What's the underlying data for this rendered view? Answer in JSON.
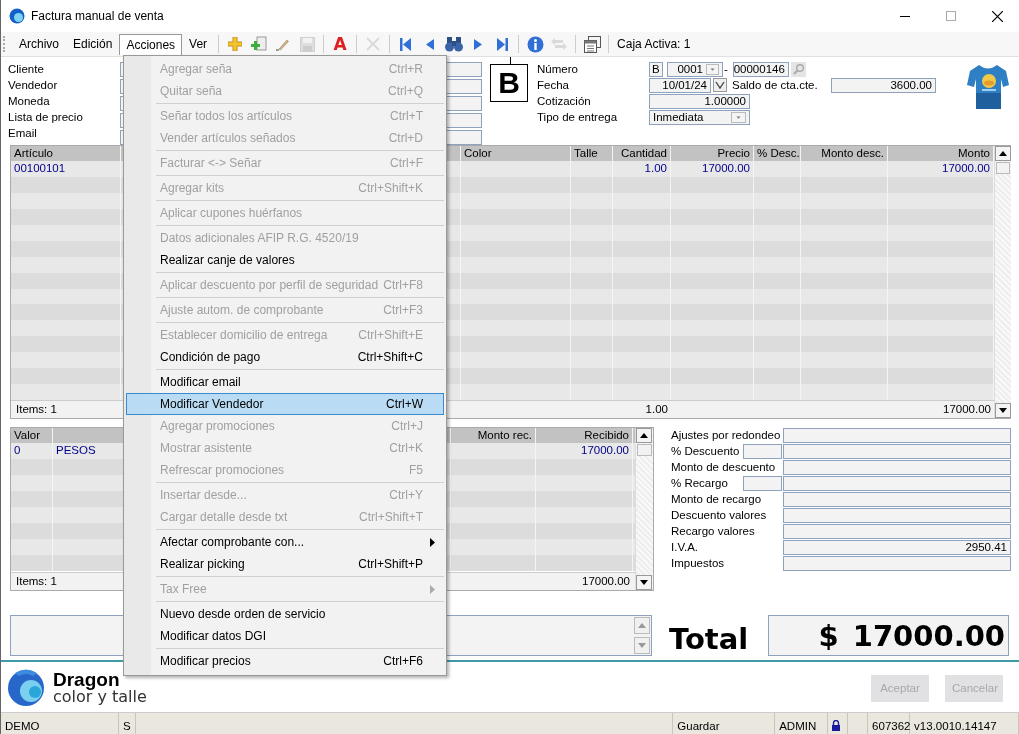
{
  "window": {
    "title": "Factura manual de venta"
  },
  "menubar": [
    {
      "label": "Archivo",
      "selected": false
    },
    {
      "label": "Edición",
      "selected": false
    },
    {
      "label": "Acciones",
      "selected": true
    },
    {
      "label": "Ver",
      "selected": false
    }
  ],
  "toolbar": {
    "groups": [
      [
        {
          "kind": "add",
          "disabled": false
        },
        {
          "kind": "add_item",
          "disabled": false
        },
        {
          "kind": "edit",
          "disabled": false
        },
        {
          "kind": "save",
          "disabled": true
        }
      ],
      [
        {
          "kind": "font",
          "glyph": "A",
          "disabled": false
        }
      ],
      [
        {
          "kind": "delete",
          "disabled": true
        }
      ],
      [
        {
          "kind": "first",
          "disabled": false
        },
        {
          "kind": "prev",
          "disabled": false
        },
        {
          "kind": "find",
          "disabled": false
        },
        {
          "kind": "next",
          "disabled": false
        },
        {
          "kind": "last",
          "disabled": false
        }
      ],
      [
        {
          "kind": "info",
          "disabled": false
        },
        {
          "kind": "swap",
          "disabled": true
        }
      ],
      [
        {
          "kind": "windows",
          "disabled": false
        }
      ]
    ],
    "caja": "Caja Activa: 1"
  },
  "customer_labels": [
    "Cliente",
    "Vendedor",
    "Moneda",
    "Lista de precio",
    "Email"
  ],
  "letter": "B",
  "document": {
    "numero": {
      "label": "Número",
      "letter": "B",
      "branch": "0001",
      "separator": "-",
      "number": "00000146"
    },
    "fecha": {
      "label": "Fecha",
      "value": "10/01/24"
    },
    "saldo": {
      "label": "Saldo de cta.cte.",
      "value": "3600.00"
    },
    "cotizacion": {
      "label": "Cotización",
      "value": "1.00000"
    },
    "tipo_entrega": {
      "label": "Tipo de entrega",
      "value": "Inmediata"
    }
  },
  "product_image": {
    "kind": "picture"
  },
  "items_grid": {
    "columns": [
      {
        "label": "Artículo",
        "kind": "text"
      },
      {
        "label": "Color",
        "kind": "text"
      },
      {
        "label": "Talle",
        "kind": "text"
      },
      {
        "label": "Cantidad",
        "kind": "number",
        "total": "1.00"
      },
      {
        "label": "Precio",
        "kind": "number"
      },
      {
        "label": "% Desc.",
        "kind": "number"
      },
      {
        "label": "Monto desc.",
        "kind": "number"
      },
      {
        "label": "Monto",
        "kind": "number",
        "total": "17000.00"
      }
    ],
    "rows": [
      {
        "cells": [
          "00100101",
          null,
          null,
          "1.00",
          "17000.00",
          null,
          null,
          "17000.00"
        ]
      }
    ],
    "items_count": "Items: 1"
  },
  "values_grid": {
    "columns": [
      {
        "label": "Valor",
        "kind": "text"
      },
      {
        "kind": "text"
      },
      {
        "label": "Monto rec.",
        "kind": "number"
      },
      {
        "label": "Recibido",
        "kind": "number",
        "total": "17000.00"
      }
    ],
    "rows": [
      {
        "cells": [
          "0",
          "PESOS",
          null,
          "17000.00"
        ]
      }
    ],
    "items_count": "Items: 1"
  },
  "adjustments": [
    {
      "label": "Ajustes por redondeo",
      "kind": "single"
    },
    {
      "label": "% Descuento",
      "kind": "percent"
    },
    {
      "label": "Monto de descuento",
      "kind": "single"
    },
    {
      "label": "% Recargo",
      "kind": "percent"
    },
    {
      "label": "Monto de recargo",
      "kind": "single"
    },
    {
      "label": "Descuento valores",
      "kind": "single"
    },
    {
      "label": "Recargo valores",
      "kind": "single"
    },
    {
      "label": "I.V.A.",
      "kind": "single",
      "value": "2950.41"
    },
    {
      "label": "Impuestos",
      "kind": "single"
    }
  ],
  "total": {
    "label": "Total",
    "currency": "$",
    "amount": "17000.00"
  },
  "logo": {
    "name": "Dragon",
    "tagline": "color y talle"
  },
  "buttons": [
    {
      "label": "Aceptar",
      "disabled": true
    },
    {
      "label": "Cancelar",
      "disabled": true
    }
  ],
  "status_bar": [
    {
      "kind": "text",
      "text": "DEMO"
    },
    {
      "kind": "text",
      "text": "S"
    },
    {
      "kind": "blank"
    },
    {
      "kind": "text",
      "text": "Guardar"
    },
    {
      "kind": "text",
      "text": "ADMIN"
    },
    {
      "kind": "lock"
    },
    {
      "kind": "blank"
    },
    {
      "kind": "text",
      "text": "607362"
    },
    {
      "kind": "text",
      "text": "v13.0010.14147"
    }
  ],
  "menu": {
    "groups": [
      [
        {
          "label": "Agregar seña",
          "shortcut": "Ctrl+R",
          "disabled": true,
          "selected": false,
          "submenu": false
        },
        {
          "label": "Quitar seña",
          "shortcut": "Ctrl+Q",
          "disabled": true,
          "selected": false,
          "submenu": false
        }
      ],
      [
        {
          "label": "Señar todos los artículos",
          "shortcut": "Ctrl+T",
          "disabled": true,
          "selected": false,
          "submenu": false
        },
        {
          "label": "Vender artículos señados",
          "shortcut": "Ctrl+D",
          "disabled": true,
          "selected": false,
          "submenu": false
        }
      ],
      [
        {
          "label": "Facturar <-> Señar",
          "shortcut": "Ctrl+F",
          "disabled": true,
          "selected": false,
          "submenu": false
        }
      ],
      [
        {
          "label": "Agregar kits",
          "shortcut": "Ctrl+Shift+K",
          "disabled": true,
          "selected": false,
          "submenu": false
        }
      ],
      [
        {
          "label": "Aplicar cupones huérfanos",
          "disabled": true,
          "selected": false,
          "submenu": false
        }
      ],
      [
        {
          "label": "Datos adicionales AFIP R.G. 4520/19",
          "disabled": true,
          "selected": false,
          "submenu": false
        },
        {
          "label": "Realizar canje de valores",
          "disabled": false,
          "selected": false,
          "submenu": false
        }
      ],
      [
        {
          "label": "Aplicar descuento por perfil de seguridad",
          "shortcut": "Ctrl+F8",
          "disabled": true,
          "selected": false,
          "submenu": false
        }
      ],
      [
        {
          "label": "Ajuste autom. de comprobante",
          "shortcut": "Ctrl+F3",
          "disabled": true,
          "selected": false,
          "submenu": false
        }
      ],
      [
        {
          "label": "Establecer domicilio de entrega",
          "shortcut": "Ctrl+Shift+E",
          "disabled": true,
          "selected": false,
          "submenu": false
        },
        {
          "label": "Condición de pago",
          "shortcut": "Ctrl+Shift+C",
          "disabled": false,
          "selected": false,
          "submenu": false
        }
      ],
      [
        {
          "label": "Modificar email",
          "disabled": false,
          "selected": false,
          "submenu": false
        },
        {
          "label": "Modificar Vendedor",
          "shortcut": "Ctrl+W",
          "disabled": false,
          "selected": true,
          "submenu": false
        },
        {
          "label": "Agregar promociones",
          "shortcut": "Ctrl+J",
          "disabled": true,
          "selected": false,
          "submenu": false
        },
        {
          "label": "Mostrar asistente",
          "shortcut": "Ctrl+K",
          "disabled": true,
          "selected": false,
          "submenu": false
        },
        {
          "label": "Refrescar promociones",
          "shortcut": "F5",
          "disabled": true,
          "selected": false,
          "submenu": false
        }
      ],
      [
        {
          "label": "Insertar desde...",
          "shortcut": "Ctrl+Y",
          "disabled": true,
          "selected": false,
          "submenu": false
        },
        {
          "label": "Cargar detalle desde txt",
          "shortcut": "Ctrl+Shift+T",
          "disabled": true,
          "selected": false,
          "submenu": false
        }
      ],
      [
        {
          "label": "Afectar comprobante con...",
          "disabled": false,
          "selected": false,
          "submenu": true
        },
        {
          "label": "Realizar picking",
          "shortcut": "Ctrl+Shift+P",
          "disabled": false,
          "selected": false,
          "submenu": false
        }
      ],
      [
        {
          "label": "Tax Free",
          "disabled": true,
          "selected": false,
          "submenu": true
        }
      ],
      [
        {
          "label": "Nuevo desde orden de servicio",
          "disabled": false,
          "selected": false,
          "submenu": false
        },
        {
          "label": "Modificar datos DGI",
          "disabled": false,
          "selected": false,
          "submenu": false
        }
      ],
      [
        {
          "label": "Modificar precios",
          "shortcut": "Ctrl+F6",
          "disabled": false,
          "selected": false,
          "submenu": false
        }
      ]
    ]
  }
}
